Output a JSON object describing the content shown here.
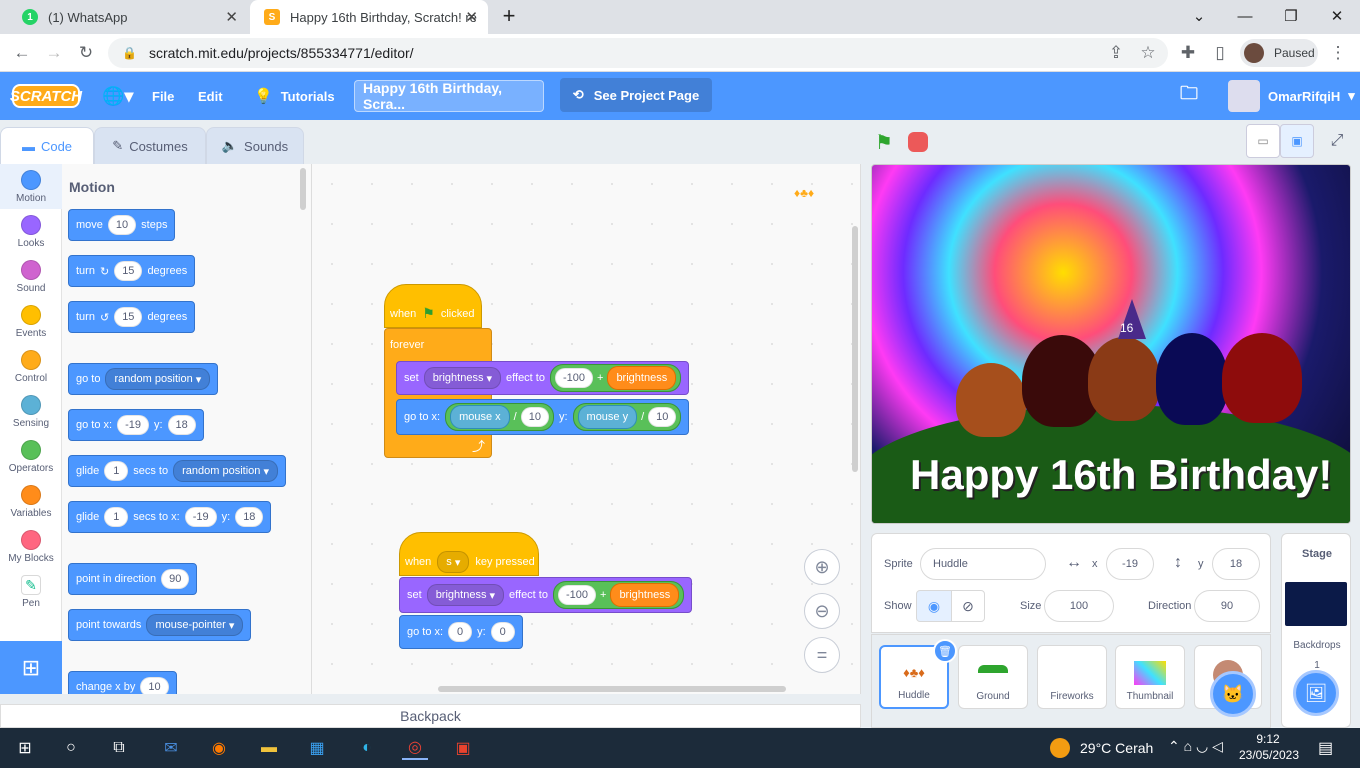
{
  "browser": {
    "tabs": [
      {
        "title": "(1) WhatsApp",
        "badge": "1"
      },
      {
        "title": "Happy 16th Birthday, Scratch! re"
      }
    ],
    "url": "scratch.mit.edu/projects/855334771/editor/",
    "profile_status": "Paused"
  },
  "menubar": {
    "logo": "SCRATCH",
    "file": "File",
    "edit": "Edit",
    "tutorials": "Tutorials",
    "project_title": "Happy 16th Birthday, Scra...",
    "see_project": "See Project Page",
    "username": "OmarRifqiH"
  },
  "editor_tabs": {
    "code": "Code",
    "costumes": "Costumes",
    "sounds": "Sounds"
  },
  "categories": [
    {
      "label": "Motion",
      "color": "#4c97ff"
    },
    {
      "label": "Looks",
      "color": "#9966ff"
    },
    {
      "label": "Sound",
      "color": "#cf63cf"
    },
    {
      "label": "Events",
      "color": "#ffbf00"
    },
    {
      "label": "Control",
      "color": "#ffab19"
    },
    {
      "label": "Sensing",
      "color": "#5cb1d6"
    },
    {
      "label": "Operators",
      "color": "#59c059"
    },
    {
      "label": "Variables",
      "color": "#ff8c1a"
    },
    {
      "label": "My Blocks",
      "color": "#ff6680"
    },
    {
      "label": "Pen",
      "color": "#ffffff"
    }
  ],
  "palette": {
    "title": "Motion",
    "move": {
      "a": "move",
      "v": "10",
      "b": "steps"
    },
    "turn_right": {
      "a": "turn",
      "v": "15",
      "b": "degrees"
    },
    "turn_left": {
      "a": "turn",
      "v": "15",
      "b": "degrees"
    },
    "goto": {
      "a": "go to",
      "dd": "random position"
    },
    "gotoxy": {
      "a": "go to x:",
      "x": "-19",
      "b": "y:",
      "y": "18"
    },
    "glide": {
      "a": "glide",
      "v": "1",
      "b": "secs to",
      "dd": "random position"
    },
    "glidexy": {
      "a": "glide",
      "v": "1",
      "b": "secs to x:",
      "x": "-19",
      "c": "y:",
      "y": "18"
    },
    "point_dir": {
      "a": "point in direction",
      "v": "90"
    },
    "point_towards": {
      "a": "point towards",
      "dd": "mouse-pointer"
    },
    "changex": {
      "a": "change x by",
      "v": "10"
    }
  },
  "script1": {
    "hat": {
      "a": "when",
      "b": "clicked"
    },
    "forever": "forever",
    "set": {
      "a": "set",
      "dd": "brightness",
      "b": "effect to",
      "n": "-100",
      "op": "+",
      "rep": "brightness"
    },
    "goto": {
      "a": "go to x:",
      "mx": "mouse x",
      "div1": "/",
      "n1": "10",
      "b": "y:",
      "my": "mouse y",
      "div2": "/",
      "n2": "10"
    }
  },
  "script2": {
    "hat": {
      "a": "when",
      "key": "s",
      "b": "key pressed"
    },
    "set": {
      "a": "set",
      "dd": "brightness",
      "b": "effect to",
      "n": "-100",
      "op": "+",
      "rep": "brightness"
    },
    "goto": {
      "a": "go to x:",
      "x": "0",
      "b": "y:",
      "y": "0"
    }
  },
  "backpack": "Backpack",
  "stage": {
    "text": "Happy 16th Birthday!",
    "hat_number": "16"
  },
  "sprite_info": {
    "sprite_label": "Sprite",
    "sprite_name": "Huddle",
    "x_label": "x",
    "x": "-19",
    "y_label": "y",
    "y": "18",
    "show_label": "Show",
    "size_label": "Size",
    "size": "100",
    "direction_label": "Direction",
    "direction": "90"
  },
  "sprites": [
    {
      "name": "Huddle",
      "selected": true
    },
    {
      "name": "Ground"
    },
    {
      "name": "Fireworks"
    },
    {
      "name": "Thumbnail"
    }
  ],
  "stage_panel": {
    "title": "Stage",
    "backdrops_label": "Backdrops",
    "backdrops_count": "1"
  },
  "taskbar": {
    "weather": "29°C  Cerah",
    "time": "9:12",
    "date": "23/05/2023"
  }
}
